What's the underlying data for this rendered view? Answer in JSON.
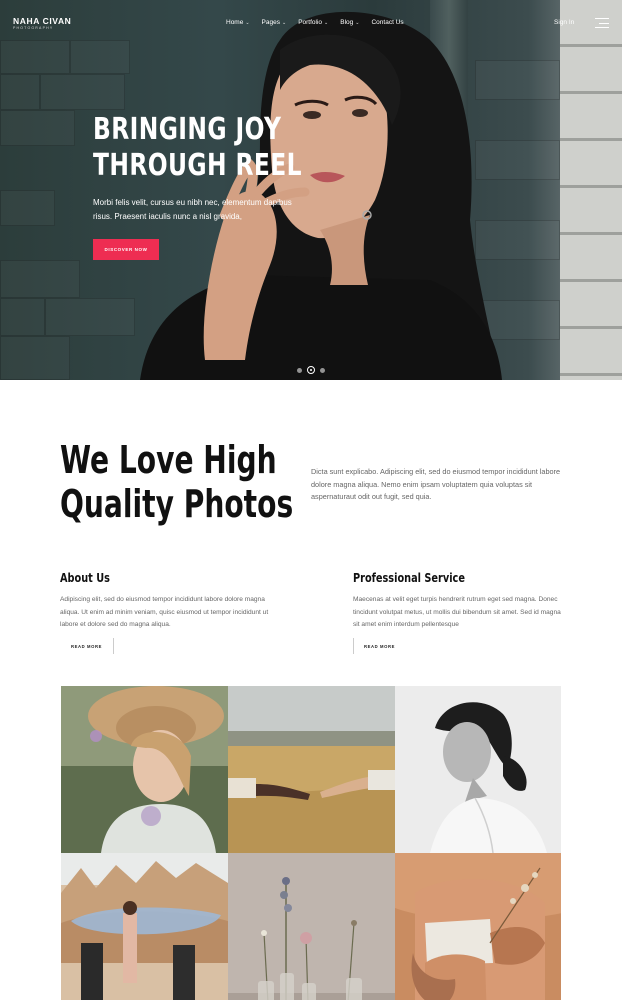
{
  "header": {
    "logo": "NAHA CIVAN",
    "logo_sub": "PHOTOGRAPHY",
    "menu": [
      {
        "label": "Home",
        "dropdown": true
      },
      {
        "label": "Pages",
        "dropdown": true
      },
      {
        "label": "Portfolio",
        "dropdown": true
      },
      {
        "label": "Blog",
        "dropdown": true
      },
      {
        "label": "Contact Us",
        "dropdown": false
      }
    ],
    "signin": "Sign In",
    "menu_icon": "hamburger-icon"
  },
  "hero": {
    "title_line1": "BRINGING JOY",
    "title_line2": "THROUGH REEL",
    "text": "Morbi felis velit, cursus eu nibh nec, elementum dapibus risus. Praesent iaculis nunc a nisl gravida,",
    "button": "DISCOVER NOW",
    "slides": 3,
    "active_slide": 2
  },
  "intro": {
    "heading_line1": "We Love High",
    "heading_line2": "Quality Photos",
    "text": "Dicta sunt explicabo. Adipiscing elit, sed do eiusmod tempor incididunt labore dolore magna aliqua. Nemo enim ipsam voluptatem quia voluptas sit aspernaturaut odit out fugit, sed quia."
  },
  "features": [
    {
      "title": "About Us",
      "text": "Adipiscing elit, sed do eiusmod tempor incididunt labore dolore magna aliqua. Ut enim ad minim veniam, quisc eiusmod ut tempor incididunt ut labore et dolore sed do magna aliqua.",
      "link": "READ MORE"
    },
    {
      "title": "Professional Service",
      "text": "Maecenas at velit eget turpis hendrerit rutrum eget sed magna. Donec tincidunt volutpat metus, ut mollis dui bibendum sit amet. Sed id magna sit amet enim interdum pellentesque",
      "link": "READ MORE"
    }
  ],
  "colors": {
    "accent": "#ee2d52",
    "heading": "#111111",
    "body_text": "#666666"
  },
  "gallery": [
    {
      "subject": "woman in straw hat"
    },
    {
      "subject": "hands reaching over wheat field"
    },
    {
      "subject": "black and white portrait"
    },
    {
      "subject": "group in desert with fabric"
    },
    {
      "subject": "dried flowers in glass vases"
    },
    {
      "subject": "hands holding dried plants"
    }
  ]
}
